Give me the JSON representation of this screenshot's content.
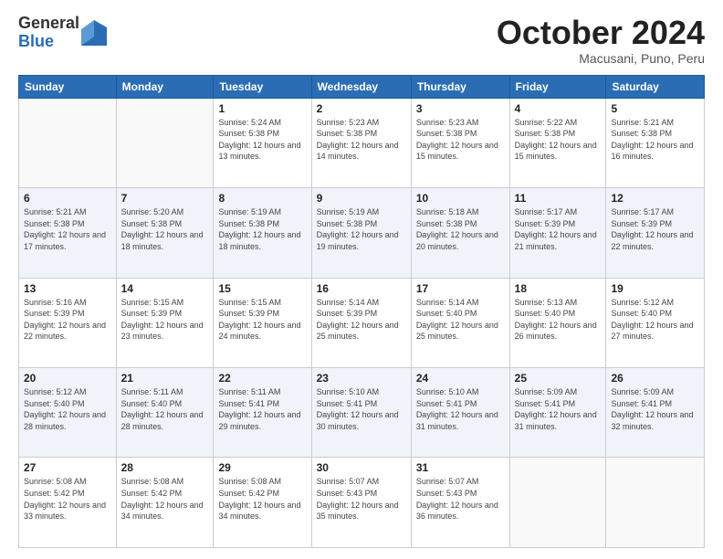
{
  "logo": {
    "general": "General",
    "blue": "Blue"
  },
  "header": {
    "month": "October 2024",
    "location": "Macusani, Puno, Peru"
  },
  "weekdays": [
    "Sunday",
    "Monday",
    "Tuesday",
    "Wednesday",
    "Thursday",
    "Friday",
    "Saturday"
  ],
  "weeks": [
    [
      {
        "day": "",
        "sunrise": "",
        "sunset": "",
        "daylight": ""
      },
      {
        "day": "",
        "sunrise": "",
        "sunset": "",
        "daylight": ""
      },
      {
        "day": "1",
        "sunrise": "Sunrise: 5:24 AM",
        "sunset": "Sunset: 5:38 PM",
        "daylight": "Daylight: 12 hours and 13 minutes."
      },
      {
        "day": "2",
        "sunrise": "Sunrise: 5:23 AM",
        "sunset": "Sunset: 5:38 PM",
        "daylight": "Daylight: 12 hours and 14 minutes."
      },
      {
        "day": "3",
        "sunrise": "Sunrise: 5:23 AM",
        "sunset": "Sunset: 5:38 PM",
        "daylight": "Daylight: 12 hours and 15 minutes."
      },
      {
        "day": "4",
        "sunrise": "Sunrise: 5:22 AM",
        "sunset": "Sunset: 5:38 PM",
        "daylight": "Daylight: 12 hours and 15 minutes."
      },
      {
        "day": "5",
        "sunrise": "Sunrise: 5:21 AM",
        "sunset": "Sunset: 5:38 PM",
        "daylight": "Daylight: 12 hours and 16 minutes."
      }
    ],
    [
      {
        "day": "6",
        "sunrise": "Sunrise: 5:21 AM",
        "sunset": "Sunset: 5:38 PM",
        "daylight": "Daylight: 12 hours and 17 minutes."
      },
      {
        "day": "7",
        "sunrise": "Sunrise: 5:20 AM",
        "sunset": "Sunset: 5:38 PM",
        "daylight": "Daylight: 12 hours and 18 minutes."
      },
      {
        "day": "8",
        "sunrise": "Sunrise: 5:19 AM",
        "sunset": "Sunset: 5:38 PM",
        "daylight": "Daylight: 12 hours and 18 minutes."
      },
      {
        "day": "9",
        "sunrise": "Sunrise: 5:19 AM",
        "sunset": "Sunset: 5:38 PM",
        "daylight": "Daylight: 12 hours and 19 minutes."
      },
      {
        "day": "10",
        "sunrise": "Sunrise: 5:18 AM",
        "sunset": "Sunset: 5:38 PM",
        "daylight": "Daylight: 12 hours and 20 minutes."
      },
      {
        "day": "11",
        "sunrise": "Sunrise: 5:17 AM",
        "sunset": "Sunset: 5:39 PM",
        "daylight": "Daylight: 12 hours and 21 minutes."
      },
      {
        "day": "12",
        "sunrise": "Sunrise: 5:17 AM",
        "sunset": "Sunset: 5:39 PM",
        "daylight": "Daylight: 12 hours and 22 minutes."
      }
    ],
    [
      {
        "day": "13",
        "sunrise": "Sunrise: 5:16 AM",
        "sunset": "Sunset: 5:39 PM",
        "daylight": "Daylight: 12 hours and 22 minutes."
      },
      {
        "day": "14",
        "sunrise": "Sunrise: 5:15 AM",
        "sunset": "Sunset: 5:39 PM",
        "daylight": "Daylight: 12 hours and 23 minutes."
      },
      {
        "day": "15",
        "sunrise": "Sunrise: 5:15 AM",
        "sunset": "Sunset: 5:39 PM",
        "daylight": "Daylight: 12 hours and 24 minutes."
      },
      {
        "day": "16",
        "sunrise": "Sunrise: 5:14 AM",
        "sunset": "Sunset: 5:39 PM",
        "daylight": "Daylight: 12 hours and 25 minutes."
      },
      {
        "day": "17",
        "sunrise": "Sunrise: 5:14 AM",
        "sunset": "Sunset: 5:40 PM",
        "daylight": "Daylight: 12 hours and 25 minutes."
      },
      {
        "day": "18",
        "sunrise": "Sunrise: 5:13 AM",
        "sunset": "Sunset: 5:40 PM",
        "daylight": "Daylight: 12 hours and 26 minutes."
      },
      {
        "day": "19",
        "sunrise": "Sunrise: 5:12 AM",
        "sunset": "Sunset: 5:40 PM",
        "daylight": "Daylight: 12 hours and 27 minutes."
      }
    ],
    [
      {
        "day": "20",
        "sunrise": "Sunrise: 5:12 AM",
        "sunset": "Sunset: 5:40 PM",
        "daylight": "Daylight: 12 hours and 28 minutes."
      },
      {
        "day": "21",
        "sunrise": "Sunrise: 5:11 AM",
        "sunset": "Sunset: 5:40 PM",
        "daylight": "Daylight: 12 hours and 28 minutes."
      },
      {
        "day": "22",
        "sunrise": "Sunrise: 5:11 AM",
        "sunset": "Sunset: 5:41 PM",
        "daylight": "Daylight: 12 hours and 29 minutes."
      },
      {
        "day": "23",
        "sunrise": "Sunrise: 5:10 AM",
        "sunset": "Sunset: 5:41 PM",
        "daylight": "Daylight: 12 hours and 30 minutes."
      },
      {
        "day": "24",
        "sunrise": "Sunrise: 5:10 AM",
        "sunset": "Sunset: 5:41 PM",
        "daylight": "Daylight: 12 hours and 31 minutes."
      },
      {
        "day": "25",
        "sunrise": "Sunrise: 5:09 AM",
        "sunset": "Sunset: 5:41 PM",
        "daylight": "Daylight: 12 hours and 31 minutes."
      },
      {
        "day": "26",
        "sunrise": "Sunrise: 5:09 AM",
        "sunset": "Sunset: 5:41 PM",
        "daylight": "Daylight: 12 hours and 32 minutes."
      }
    ],
    [
      {
        "day": "27",
        "sunrise": "Sunrise: 5:08 AM",
        "sunset": "Sunset: 5:42 PM",
        "daylight": "Daylight: 12 hours and 33 minutes."
      },
      {
        "day": "28",
        "sunrise": "Sunrise: 5:08 AM",
        "sunset": "Sunset: 5:42 PM",
        "daylight": "Daylight: 12 hours and 34 minutes."
      },
      {
        "day": "29",
        "sunrise": "Sunrise: 5:08 AM",
        "sunset": "Sunset: 5:42 PM",
        "daylight": "Daylight: 12 hours and 34 minutes."
      },
      {
        "day": "30",
        "sunrise": "Sunrise: 5:07 AM",
        "sunset": "Sunset: 5:43 PM",
        "daylight": "Daylight: 12 hours and 35 minutes."
      },
      {
        "day": "31",
        "sunrise": "Sunrise: 5:07 AM",
        "sunset": "Sunset: 5:43 PM",
        "daylight": "Daylight: 12 hours and 36 minutes."
      },
      {
        "day": "",
        "sunrise": "",
        "sunset": "",
        "daylight": ""
      },
      {
        "day": "",
        "sunrise": "",
        "sunset": "",
        "daylight": ""
      }
    ]
  ]
}
